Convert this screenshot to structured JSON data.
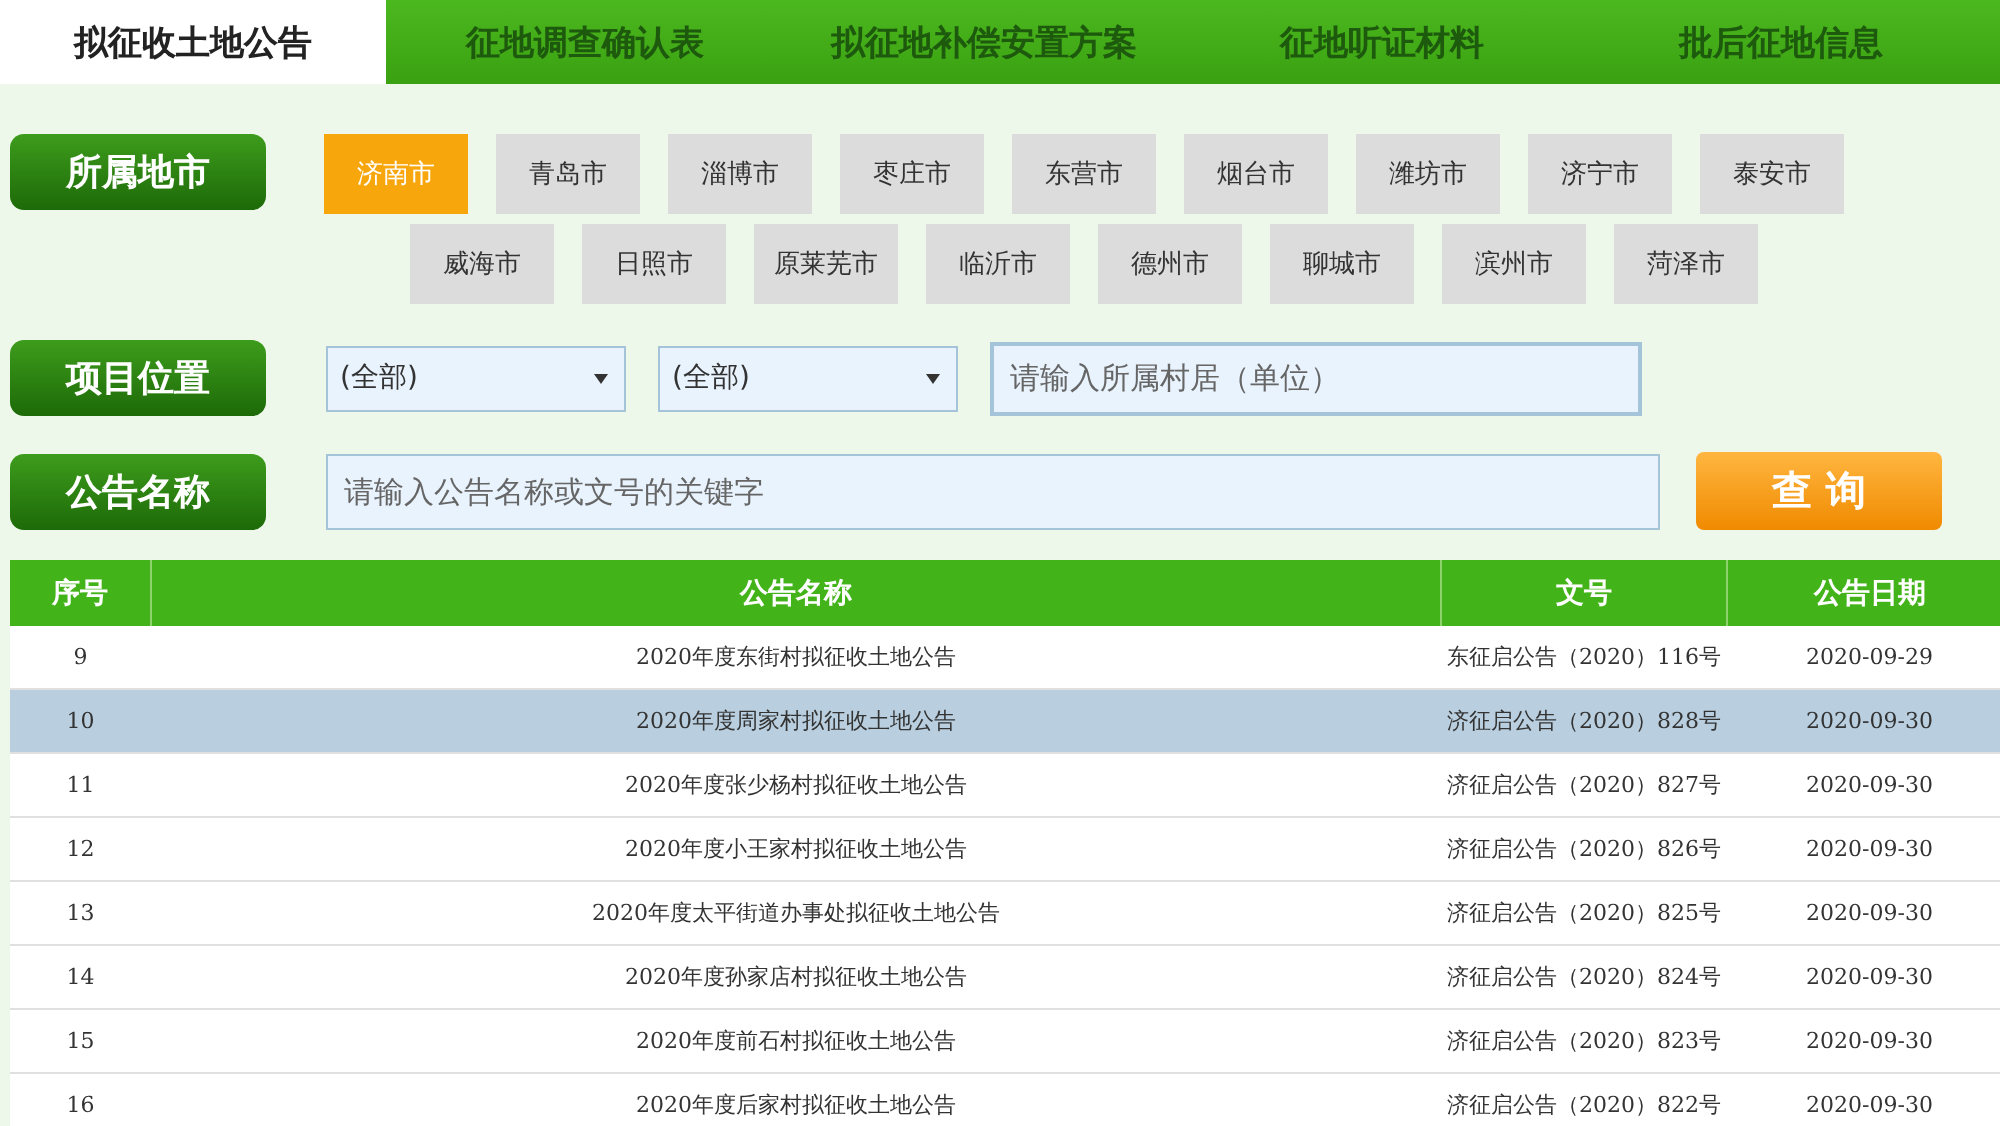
{
  "tabs": [
    {
      "label": "拟征收土地公告",
      "selected": true
    },
    {
      "label": "征地调查确认表",
      "selected": false
    },
    {
      "label": "拟征地补偿安置方案",
      "selected": false
    },
    {
      "label": "征地听证材料",
      "selected": false
    },
    {
      "label": "批后征地信息",
      "selected": false
    }
  ],
  "city_filter": {
    "label": "所属地市",
    "cities": [
      {
        "name": "济南市",
        "selected": true
      },
      {
        "name": "青岛市",
        "selected": false
      },
      {
        "name": "淄博市",
        "selected": false
      },
      {
        "name": "枣庄市",
        "selected": false
      },
      {
        "name": "东营市",
        "selected": false
      },
      {
        "name": "烟台市",
        "selected": false
      },
      {
        "name": "潍坊市",
        "selected": false
      },
      {
        "name": "济宁市",
        "selected": false
      },
      {
        "name": "泰安市",
        "selected": false
      },
      {
        "name": "威海市",
        "selected": false
      },
      {
        "name": "日照市",
        "selected": false
      },
      {
        "name": "原莱芜市",
        "selected": false
      },
      {
        "name": "临沂市",
        "selected": false
      },
      {
        "name": "德州市",
        "selected": false
      },
      {
        "name": "聊城市",
        "selected": false
      },
      {
        "name": "滨州市",
        "selected": false
      },
      {
        "name": "菏泽市",
        "selected": false
      }
    ]
  },
  "location_filter": {
    "label": "项目位置",
    "selects": [
      {
        "value": "(全部)"
      },
      {
        "value": "(全部)"
      }
    ],
    "village_field": {
      "placeholder": "请输入所属村居（单位）"
    }
  },
  "name_filter": {
    "label": "公告名称",
    "field": {
      "placeholder": "请输入公告名称或文号的关键字"
    },
    "button": "查 询"
  },
  "table": {
    "columns": [
      "序号",
      "公告名称",
      "文号",
      "公告日期"
    ],
    "rows": [
      {
        "no": "9",
        "name": "2020年度东街村拟征收土地公告",
        "doc": "东征启公告（2020）116号",
        "date": "2020-09-29",
        "selected": false
      },
      {
        "no": "10",
        "name": "2020年度周家村拟征收土地公告",
        "doc": "济征启公告（2020）828号",
        "date": "2020-09-30",
        "selected": true
      },
      {
        "no": "11",
        "name": "2020年度张少杨村拟征收土地公告",
        "doc": "济征启公告（2020）827号",
        "date": "2020-09-30",
        "selected": false
      },
      {
        "no": "12",
        "name": "2020年度小王家村拟征收土地公告",
        "doc": "济征启公告（2020）826号",
        "date": "2020-09-30",
        "selected": false
      },
      {
        "no": "13",
        "name": "2020年度太平街道办事处拟征收土地公告",
        "doc": "济征启公告（2020）825号",
        "date": "2020-09-30",
        "selected": false
      },
      {
        "no": "14",
        "name": "2020年度孙家店村拟征收土地公告",
        "doc": "济征启公告（2020）824号",
        "date": "2020-09-30",
        "selected": false
      },
      {
        "no": "15",
        "name": "2020年度前石村拟征收土地公告",
        "doc": "济征启公告（2020）823号",
        "date": "2020-09-30",
        "selected": false
      },
      {
        "no": "16",
        "name": "2020年度后家村拟征收土地公告",
        "doc": "济征启公告（2020）822号",
        "date": "2020-09-30",
        "selected": false
      }
    ]
  }
}
